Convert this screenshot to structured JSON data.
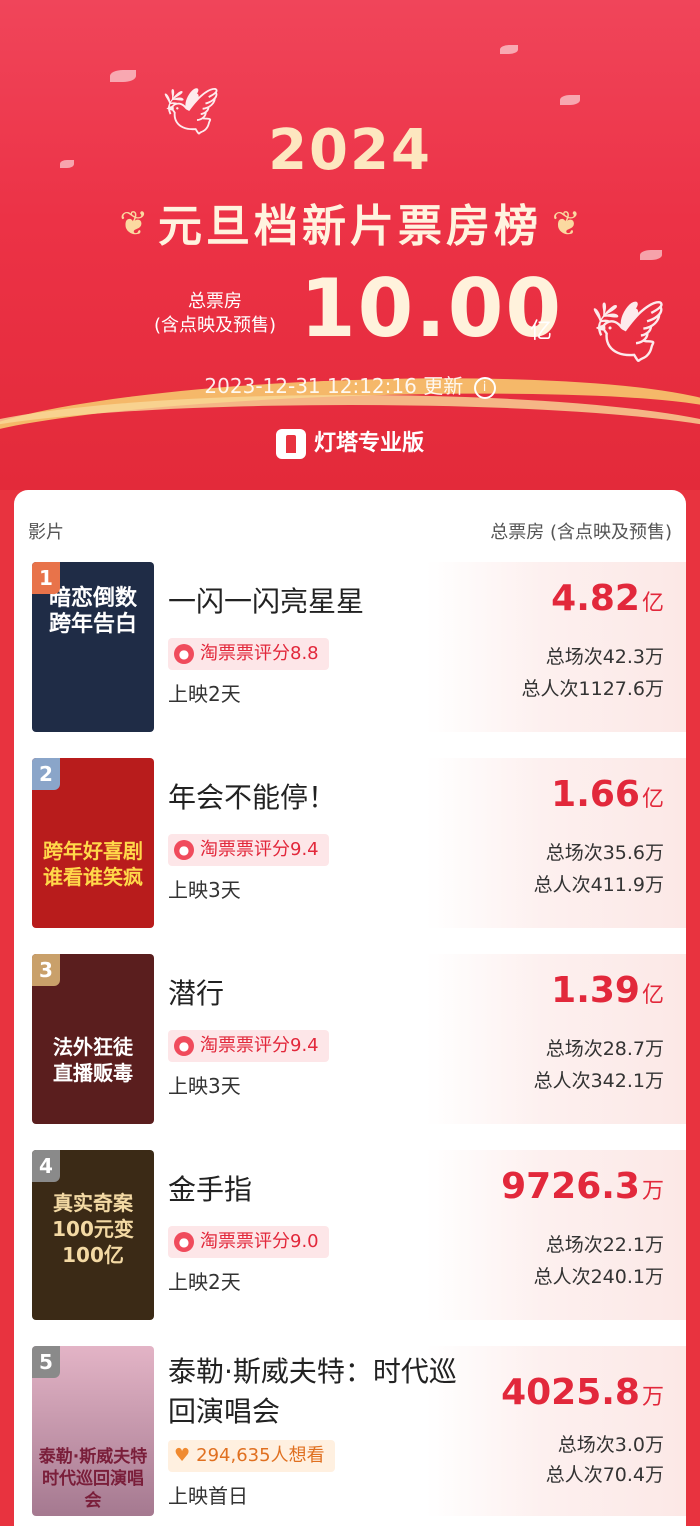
{
  "header": {
    "year": "2024",
    "title": "元旦档新片票房榜",
    "total_label_line1": "总票房",
    "total_label_line2": "(含点映及预售)",
    "total_value": "10.00",
    "total_unit": "亿",
    "updated_time": "2023-12-31 12:12:16",
    "updated_label": "更新",
    "brand": "灯塔专业版"
  },
  "table": {
    "col_left": "影片",
    "col_right": "总票房 (含点映及预售)"
  },
  "movies": [
    {
      "rank": "1",
      "title": "一闪一闪亮星星",
      "badge": "淘票票评分8.8",
      "days": "上映2天",
      "box": "4.82",
      "unit": "亿",
      "shows": "总场次42.3万",
      "viewers": "总人次1127.6万",
      "poster_text": "暗恋倒数\n跨年告白",
      "poster_color": "#1f2c46"
    },
    {
      "rank": "2",
      "title": "年会不能停！",
      "badge": "淘票票评分9.4",
      "days": "上映3天",
      "box": "1.66",
      "unit": "亿",
      "shows": "总场次35.6万",
      "viewers": "总人次411.9万",
      "poster_text": "跨年好喜剧\n谁看谁笑疯",
      "poster_color": "#b81c1c"
    },
    {
      "rank": "3",
      "title": "潜行",
      "badge": "淘票票评分9.4",
      "days": "上映3天",
      "box": "1.39",
      "unit": "亿",
      "shows": "总场次28.7万",
      "viewers": "总人次342.1万",
      "poster_text": "法外狂徒\n直播贩毒",
      "poster_color": "#5a1e1e"
    },
    {
      "rank": "4",
      "title": "金手指",
      "badge": "淘票票评分9.0",
      "days": "上映2天",
      "box": "9726.3",
      "unit": "万",
      "shows": "总场次22.1万",
      "viewers": "总人次240.1万",
      "poster_text": "真实奇案\n100元变100亿",
      "poster_color": "#3b2a16"
    },
    {
      "rank": "5",
      "title": "泰勒·斯威夫特：时代巡回演唱会",
      "badge": "294,635人想看",
      "days": "上映首日",
      "box": "4025.8",
      "unit": "万",
      "shows": "总场次3.0万",
      "viewers": "总人次70.4万",
      "poster_text": "泰勒·斯威夫特\n时代巡回演唱会",
      "poster_color": "#c98fa8"
    }
  ]
}
